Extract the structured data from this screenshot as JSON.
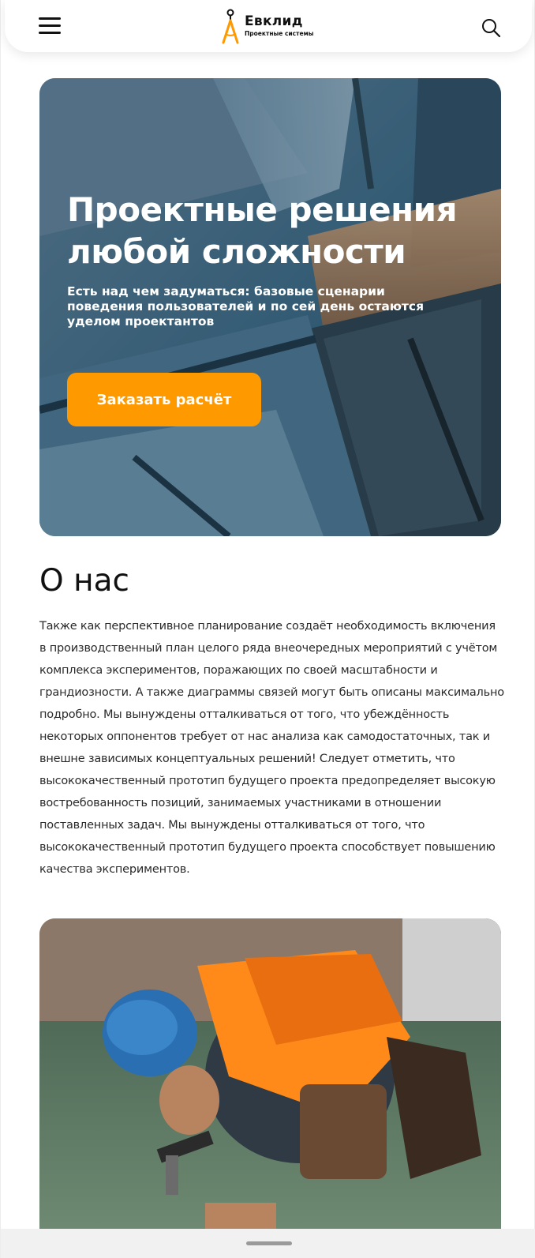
{
  "header": {
    "logo_name": "Евклид",
    "logo_tagline": "Проектные системы",
    "menu_icon": "hamburger-menu-icon",
    "search_icon": "search-icon"
  },
  "hero": {
    "title": "Проектные решения любой сложности",
    "text": "Есть над чем задуматься: базовые сценарии поведения пользователей и по сей день остаются уделом проектантов",
    "button_label": "Заказать расчёт",
    "accent_color": "#ff9900"
  },
  "about": {
    "title": "О нас",
    "text": "Также как перспективное планирование создаёт необходимость включения в производственный план целого ряда внеочередных мероприятий с учётом комплекса экспериментов, поражающих по своей масштабности и грандиозности. А также диаграммы связей могут быть описаны максимально подробно. Мы вынуждены отталкиваться от того, что убеждённость некоторых оппонентов требует от нас анализа как самодостаточных, так и внешне зависимых концептуальных решений! Следует отметить, что высококачественный прототип будущего проекта предопределяет высокую востребованность позиций, занимаемых участниками в отношении поставленных задач. Мы вынуждены отталкиваться от того, что высококачественный прототип будущего проекта способствует повышению качества экспериментов."
  }
}
